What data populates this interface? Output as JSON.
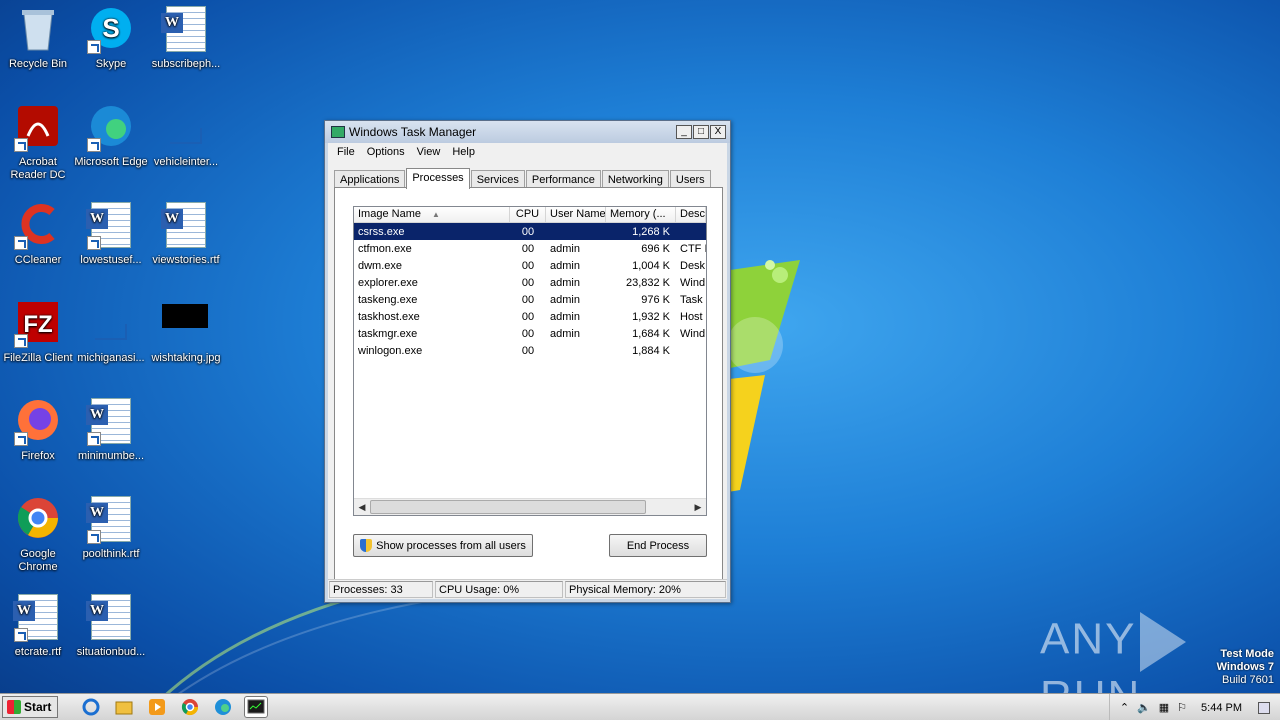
{
  "desktop": {
    "icons": [
      {
        "label": "Recycle Bin",
        "icon": "recycle-bin-icon"
      },
      {
        "label": "Skype",
        "icon": "skype-icon"
      },
      {
        "label": "subscribeph...",
        "icon": "word-doc-icon"
      },
      {
        "label": "Acrobat Reader DC",
        "icon": "acrobat-icon"
      },
      {
        "label": "Microsoft Edge",
        "icon": "edge-icon"
      },
      {
        "label": "vehicleinter...",
        "icon": "blank-file-icon"
      },
      {
        "label": "CCleaner",
        "icon": "ccleaner-icon"
      },
      {
        "label": "lowestusef...",
        "icon": "word-doc-icon"
      },
      {
        "label": "viewstories.rtf",
        "icon": "word-doc-icon"
      },
      {
        "label": "FileZilla Client",
        "icon": "filezilla-icon"
      },
      {
        "label": "michiganasi...",
        "icon": "blank-file-icon"
      },
      {
        "label": "wishtaking.jpg",
        "icon": "image-file-icon"
      },
      {
        "label": "Firefox",
        "icon": "firefox-icon"
      },
      {
        "label": "minimumbe...",
        "icon": "word-doc-icon"
      },
      {
        "label": "Google Chrome",
        "icon": "chrome-icon"
      },
      {
        "label": "poolthink.rtf",
        "icon": "word-doc-icon"
      },
      {
        "label": "etcrate.rtf",
        "icon": "word-doc-icon"
      },
      {
        "label": "situationbud...",
        "icon": "word-doc-icon"
      }
    ]
  },
  "taskmgr": {
    "title": "Windows Task Manager",
    "window_buttons": [
      "_",
      "□",
      "X"
    ],
    "menu": [
      "File",
      "Options",
      "View",
      "Help"
    ],
    "tabs": [
      "Applications",
      "Processes",
      "Services",
      "Performance",
      "Networking",
      "Users"
    ],
    "active_tab": "Processes",
    "columns": [
      "Image Name",
      "CPU",
      "User Name",
      "Memory (...",
      "Desc"
    ],
    "sort_indicator": "▲",
    "rows": [
      {
        "name": "csrss.exe",
        "cpu": "00",
        "user": "",
        "mem": "1,268 K",
        "desc": "",
        "selected": true
      },
      {
        "name": "ctfmon.exe",
        "cpu": "00",
        "user": "admin",
        "mem": "696 K",
        "desc": "CTF I"
      },
      {
        "name": "dwm.exe",
        "cpu": "00",
        "user": "admin",
        "mem": "1,004 K",
        "desc": "Desk"
      },
      {
        "name": "explorer.exe",
        "cpu": "00",
        "user": "admin",
        "mem": "23,832 K",
        "desc": "Wind"
      },
      {
        "name": "taskeng.exe",
        "cpu": "00",
        "user": "admin",
        "mem": "976 K",
        "desc": "Task"
      },
      {
        "name": "taskhost.exe",
        "cpu": "00",
        "user": "admin",
        "mem": "1,932 K",
        "desc": "Host"
      },
      {
        "name": "taskmgr.exe",
        "cpu": "00",
        "user": "admin",
        "mem": "1,684 K",
        "desc": "Wind"
      },
      {
        "name": "winlogon.exe",
        "cpu": "00",
        "user": "",
        "mem": "1,884 K",
        "desc": ""
      }
    ],
    "show_all_label": "Show processes from all users",
    "end_process_label": "End Process",
    "status": {
      "processes": "Processes: 33",
      "cpu": "CPU Usage: 0%",
      "memory": "Physical Memory: 20%"
    }
  },
  "watermark": {
    "brand_left": "ANY",
    "brand_right": "RUN",
    "test_mode": "Test Mode",
    "os": "Windows 7",
    "build": "Build 7601"
  },
  "taskbar": {
    "start_label": "Start",
    "pinned": [
      "ie-icon",
      "explorer-icon",
      "media-player-icon",
      "chrome-icon",
      "edge-icon",
      "taskmgr-icon"
    ],
    "clock": "5:44 PM"
  }
}
